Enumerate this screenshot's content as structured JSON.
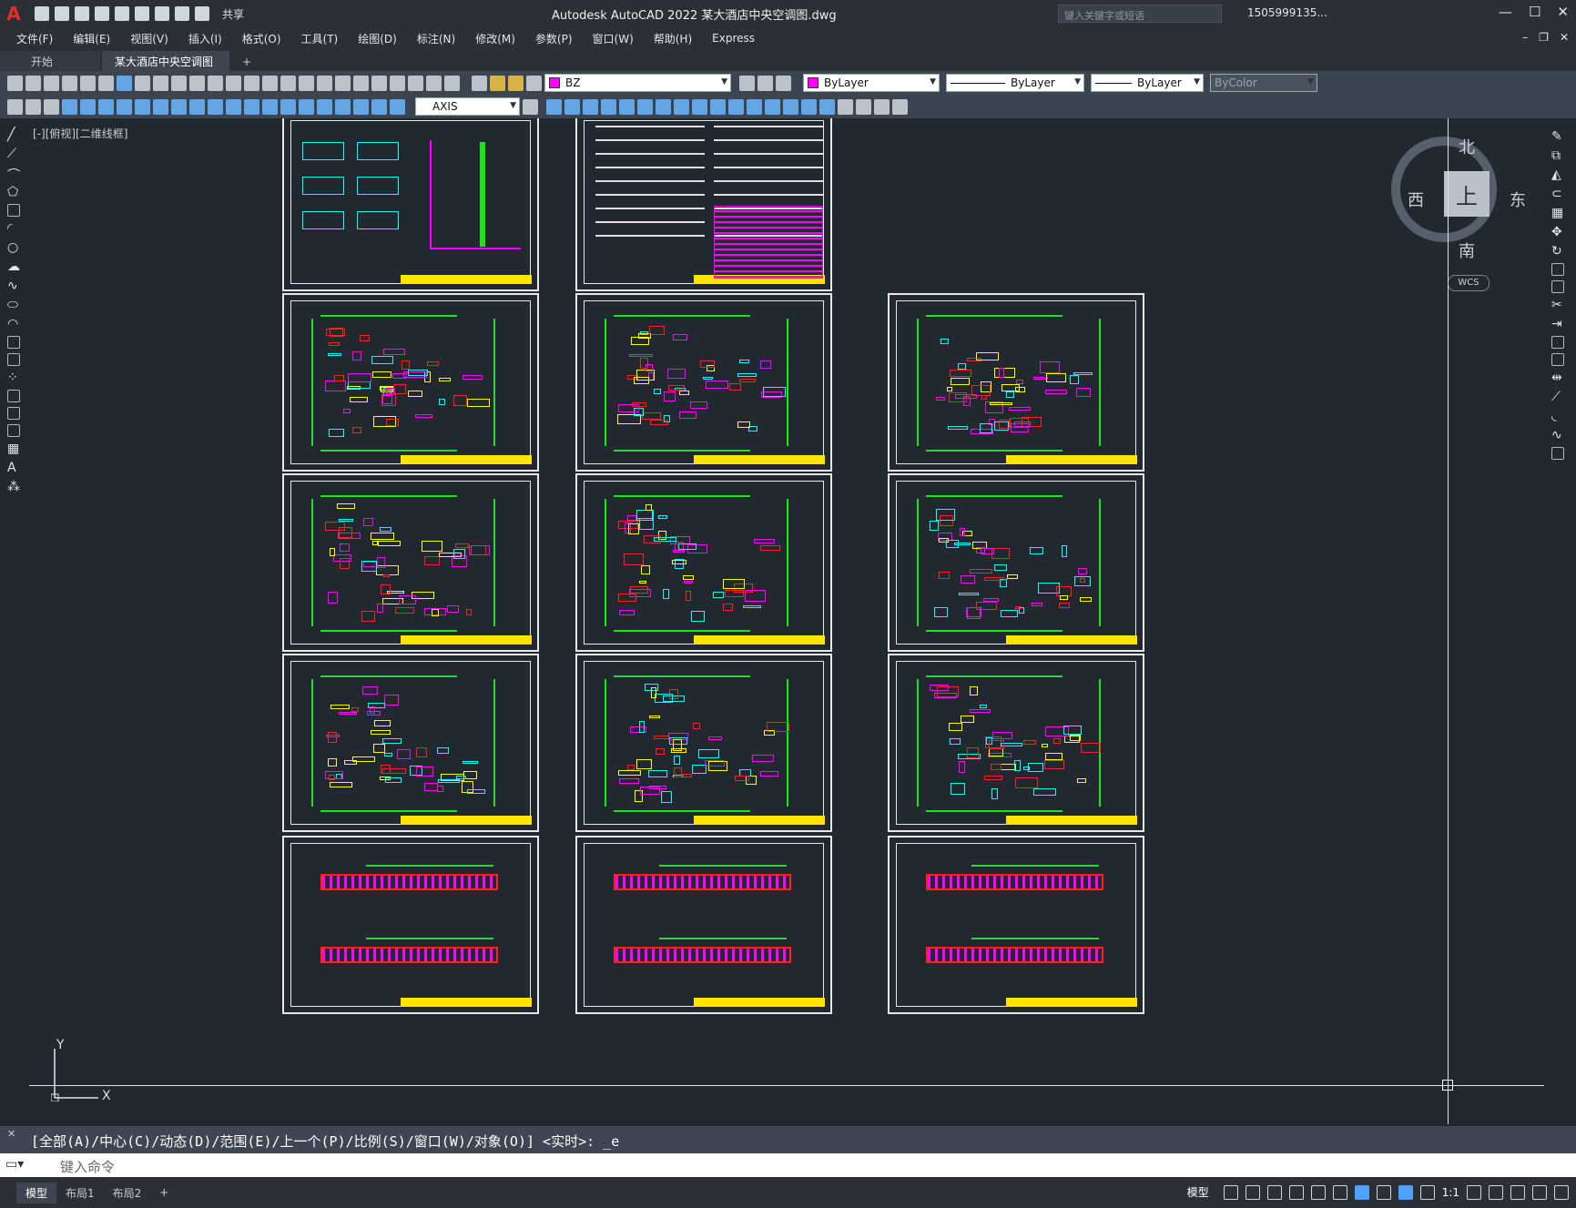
{
  "titlebar": {
    "app_initial": "A",
    "share": "共享",
    "title": "Autodesk AutoCAD 2022    某大酒店中央空调图.dwg",
    "search_placeholder": "键入关键字或短语",
    "user": "1505999135..."
  },
  "menus": [
    "文件(F)",
    "编辑(E)",
    "视图(V)",
    "插入(I)",
    "格式(O)",
    "工具(T)",
    "绘图(D)",
    "标注(N)",
    "修改(M)",
    "参数(P)",
    "窗口(W)",
    "帮助(H)",
    "Express"
  ],
  "tabs": {
    "start": "开始",
    "drawing": "某大酒店中央空调图*",
    "close": "✕",
    "add": "+"
  },
  "properties": {
    "layer": "BZ",
    "color": "ByLayer",
    "linetype": "ByLayer",
    "lineweight": "ByLayer",
    "plotstyle": "ByColor",
    "layer_color": "#ff00ff"
  },
  "dimstyle": "AXIS",
  "viewport": {
    "label": "[-][俯视][二维线框]"
  },
  "viewcube": {
    "north": "北",
    "south": "南",
    "east": "东",
    "west": "西",
    "face": "上",
    "wcs": "WCS"
  },
  "ucs": {
    "x": "X",
    "y": "Y"
  },
  "command": {
    "history": "[全部(A)/中心(C)/动态(D)/范围(E)/上一个(P)/比例(S)/窗口(W)/对象(O)] <实时>: _e",
    "placeholder": "键入命令"
  },
  "statusbar": {
    "model_tab": "模型",
    "layout1": "布局1",
    "layout2": "布局2",
    "add": "+",
    "model_button": "模型",
    "scale": "1:1"
  }
}
